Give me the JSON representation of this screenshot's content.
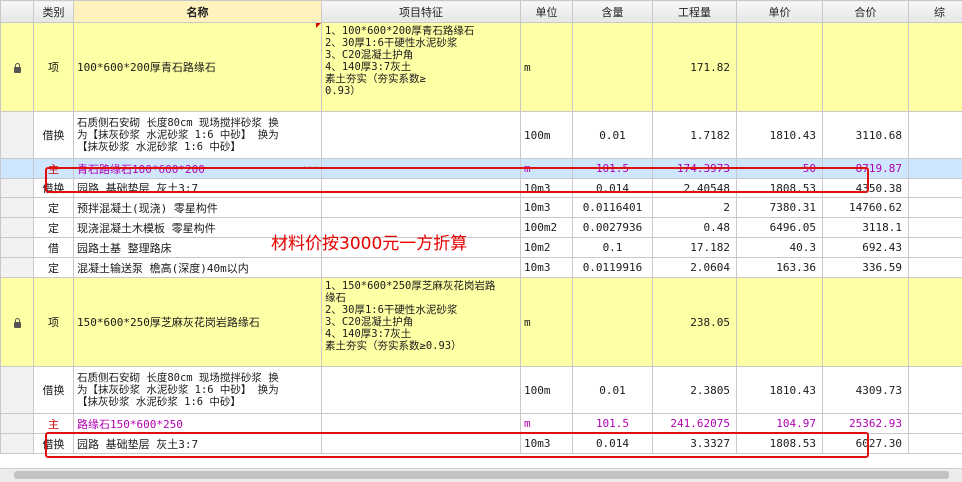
{
  "columns": {
    "col0": "",
    "type": "类别",
    "name": "名称",
    "feature": "项目特征",
    "unit": "单位",
    "content": "含量",
    "quantity": "工程量",
    "unit_price": "单价",
    "total": "合价",
    "extra": "综"
  },
  "rows": [
    {
      "type": "项",
      "name": "100*600*200厚青石路缘石",
      "feature": "1、100*600*200厚青石路缘石\n2、30厚1:6干硬性水泥砂浆\n3、C20混凝土护角\n4、140厚3:7灰土\n素土夯实（夯实系数≥\n0.93）",
      "unit": "m",
      "content": "",
      "quantity": "171.82",
      "unit_price": "",
      "total": ""
    },
    {
      "type": "借换",
      "name": "石质侧石安砌 长度80cm 现场搅拌砂浆  换\n为【抹灰砂浆 水泥砂浆 1:6 中砂】  换为\n【抹灰砂浆 水泥砂浆 1:6 中砂】",
      "feature": "",
      "unit": "100m",
      "content": "0.01",
      "quantity": "1.7182",
      "unit_price": "1810.43",
      "total": "3110.68"
    },
    {
      "type": "主",
      "name": "青石路缘石100*600*200",
      "feature": "",
      "unit": "m",
      "content": "101.5",
      "quantity": "174.3973",
      "unit_price": "50",
      "total": "8719.87"
    },
    {
      "type": "借换",
      "name": "园路 基础垫层 灰土3:7",
      "feature": "",
      "unit": "10m3",
      "content": "0.014",
      "quantity": "2.40548",
      "unit_price": "1808.53",
      "total": "4350.38"
    },
    {
      "type": "定",
      "name": "预拌混凝土(现浇) 零星构件",
      "feature": "",
      "unit": "10m3",
      "content": "0.0116401",
      "quantity": "2",
      "unit_price": "7380.31",
      "total": "14760.62"
    },
    {
      "type": "定",
      "name": "现浇混凝土木模板 零星构件",
      "feature": "",
      "unit": "100m2",
      "content": "0.0027936",
      "quantity": "0.48",
      "unit_price": "6496.05",
      "total": "3118.1"
    },
    {
      "type": "借",
      "name": "园路土基 整理路床",
      "feature": "",
      "unit": "10m2",
      "content": "0.1",
      "quantity": "17.182",
      "unit_price": "40.3",
      "total": "692.43"
    },
    {
      "type": "定",
      "name": "混凝土输送泵 檐高(深度)40m以内",
      "feature": "",
      "unit": "10m3",
      "content": "0.0119916",
      "quantity": "2.0604",
      "unit_price": "163.36",
      "total": "336.59"
    },
    {
      "type": "项",
      "name": "150*600*250厚芝麻灰花岗岩路缘石",
      "feature": "1、150*600*250厚芝麻灰花岗岩路\n缘石\n2、30厚1:6干硬性水泥砂浆\n3、C20混凝土护角\n4、140厚3:7灰土\n素土夯实（夯实系数≥0.93）",
      "unit": "m",
      "content": "",
      "quantity": "238.05",
      "unit_price": "",
      "total": ""
    },
    {
      "type": "借换",
      "name": "石质侧石安砌 长度80cm 现场搅拌砂浆  换\n为【抹灰砂浆 水泥砂浆 1:6 中砂】  换为\n【抹灰砂浆 水泥砂浆 1:6 中砂】",
      "feature": "",
      "unit": "100m",
      "content": "0.01",
      "quantity": "2.3805",
      "unit_price": "1810.43",
      "total": "4309.73"
    },
    {
      "type": "主",
      "name": "路缘石150*600*250",
      "feature": "",
      "unit": "m",
      "content": "101.5",
      "quantity": "241.62075",
      "unit_price": "104.97",
      "total": "25362.93"
    },
    {
      "type": "借换",
      "name": "园路 基础垫层 灰土3:7",
      "feature": "",
      "unit": "10m3",
      "content": "0.014",
      "quantity": "3.3327",
      "unit_price": "1808.53",
      "total": "6027.30"
    }
  ],
  "ellipsis": "···",
  "annotation": "材料价按3000元一方折算",
  "colors": {
    "highlight_row": "#ffffa6",
    "selected_row": "#cfe6ff",
    "main_material_text": "#b000b0",
    "main_type_text": "#d00000",
    "annotation": "#e60000"
  }
}
